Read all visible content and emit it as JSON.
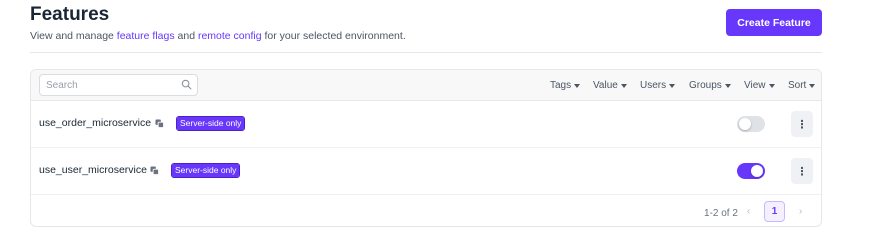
{
  "header": {
    "title": "Features",
    "subtitle_prefix": "View and manage ",
    "link_feature_flags": "feature flags",
    "subtitle_and": " and ",
    "link_remote_config": "remote config",
    "subtitle_suffix": " for your selected environment.",
    "create_button": "Create Feature"
  },
  "toolbar": {
    "search_placeholder": "Search",
    "filters": [
      "Tags",
      "Value",
      "Users",
      "Groups",
      "View",
      "Sort"
    ]
  },
  "features": [
    {
      "name": "use_order_microservice",
      "badge": "Server-side only",
      "enabled": false
    },
    {
      "name": "use_user_microservice",
      "badge": "Server-side only",
      "enabled": true
    }
  ],
  "pagination": {
    "summary": "1-2 of 2",
    "current_page": "1",
    "prev_icon": "chevron-left-icon",
    "next_icon": "chevron-right-icon"
  },
  "colors": {
    "accent": "#6837fc",
    "text": "#1a2634",
    "toggle_off": "#dfe2e6"
  }
}
